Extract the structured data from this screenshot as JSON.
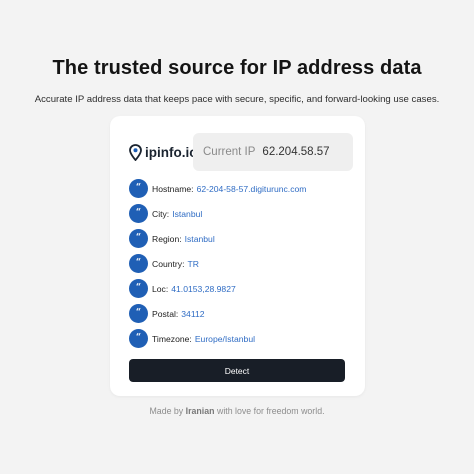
{
  "hero": {
    "title": "The trusted source for IP address data",
    "subtitle": "Accurate IP address data that keeps pace with secure, specific, and forward-looking use cases."
  },
  "card": {
    "logo": {
      "text": "ipinfo.io",
      "icon": "location-pin-icon"
    },
    "current_ip": {
      "label": "Current IP",
      "value": "62.204.58.57"
    },
    "field_icon": "quote-icon",
    "fields": [
      {
        "key": "Hostname:",
        "value": "62-204-58-57.digiturunc.com"
      },
      {
        "key": "City:",
        "value": "Istanbul"
      },
      {
        "key": "Region:",
        "value": "Istanbul"
      },
      {
        "key": "Country:",
        "value": "TR"
      },
      {
        "key": "Loc:",
        "value": "41.0153,28.9827"
      },
      {
        "key": "Postal:",
        "value": "34112"
      },
      {
        "key": "Timezone:",
        "value": "Europe/Istanbul"
      }
    ],
    "detect_label": "Detect"
  },
  "footer": {
    "prefix": "Made by",
    "author": "Iranian",
    "suffix": "with love for freedom world."
  },
  "colors": {
    "background": "#f3f3f3",
    "accent": "#1f5fb5",
    "link": "#2f6cc4",
    "button": "#181e27"
  }
}
